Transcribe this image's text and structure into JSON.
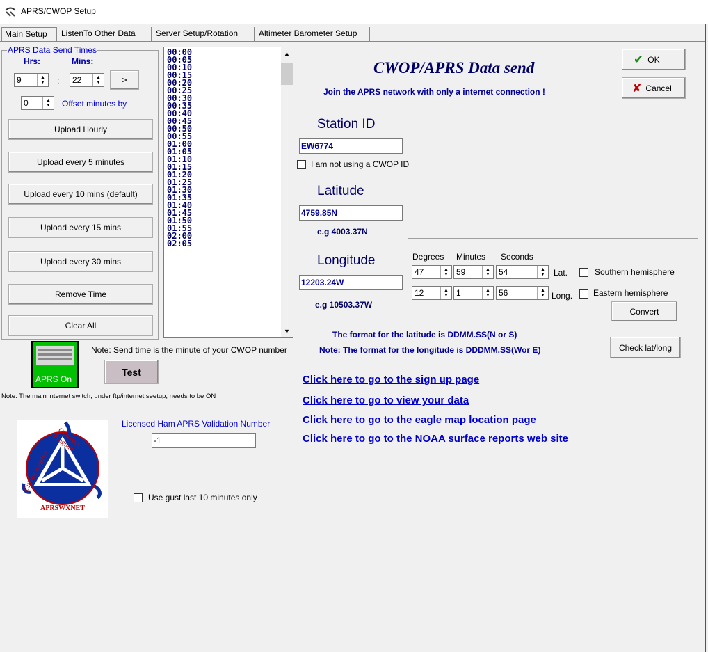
{
  "window": {
    "title": "APRS/CWOP Setup"
  },
  "tabs": [
    "Main Setup",
    "ListenTo Other Data",
    "Server Setup/Rotation",
    "Altimeter Barometer Setup"
  ],
  "send_times": {
    "group_label": "APRS Data Send Times",
    "hrs_label": "Hrs:",
    "mins_label": "Mins:",
    "hrs_value": "9",
    "mins_value": "22",
    "colon": ":",
    "arrow_button": ">",
    "offset_value": "0",
    "offset_label": "Offset minutes by"
  },
  "upload_buttons": [
    "Upload Hourly",
    "Upload every 5 minutes",
    "Upload every 10 mins (default)",
    "Upload every 15 mins",
    "Upload every 30 mins",
    "Remove Time",
    "Clear All"
  ],
  "time_list": [
    "00:00",
    "00:05",
    "00:10",
    "00:15",
    "00:20",
    "00:25",
    "00:30",
    "00:35",
    "00:40",
    "00:45",
    "00:50",
    "00:55",
    "01:00",
    "01:05",
    "01:10",
    "01:15",
    "01:20",
    "01:25",
    "01:30",
    "01:35",
    "01:40",
    "01:45",
    "01:50",
    "01:55",
    "02:00",
    "02:05"
  ],
  "toggle": {
    "label": "APRS On",
    "status_color": "#00c000"
  },
  "note_send_time": "Note: Send time is the minute of your CWOP number",
  "test_button": "Test",
  "note_internet": "Note: The main internet switch, under ftp/internet seetup, needs to be ON",
  "logo": {
    "top_text": "Observer Program",
    "left_text": "Citizen Weather",
    "bottom_text": "APRSWXNET"
  },
  "validation": {
    "label": "Licensed Ham APRS Validation Number",
    "value": "-1"
  },
  "gust_checkbox": {
    "label": "Use gust last 10 minutes only"
  },
  "header": {
    "title": "CWOP/APRS Data send",
    "subtitle": "Join the APRS network with only a internet connection !"
  },
  "ok_button": "OK",
  "cancel_button": "Cancel",
  "station": {
    "label": "Station ID",
    "value": "EW6774",
    "checkbox_label": "I am not using a CWOP ID"
  },
  "latitude": {
    "label": "Latitude",
    "value": "4759.85N",
    "example": "e.g 4003.37N"
  },
  "longitude": {
    "label": "Longitude",
    "value": "12203.24W",
    "example": "e.g 10503.37W"
  },
  "dms": {
    "degrees_label": "Degrees",
    "minutes_label": "Minutes",
    "seconds_label": "Seconds",
    "lat": {
      "deg": "47",
      "min": "59",
      "sec": "54",
      "suffix": "Lat.",
      "hemisphere_label": "Southern hemisphere"
    },
    "long": {
      "deg": "12",
      "min": "1",
      "sec": "56",
      "suffix": "Long.",
      "hemisphere_label": "Eastern hemisphere"
    },
    "convert_button": "Convert"
  },
  "format_notes": {
    "lat": "The format for the latitude is DDMM.SS(N or S)",
    "long": "Note: The format for the longitude is DDDMM.SS(Wor E)"
  },
  "check_button": "Check lat/long",
  "links": [
    "Click here to go to the sign up page",
    "Click here to go to view your data",
    "Click here to go to the eagle map location page",
    "Click here to go to the NOAA surface reports web site"
  ]
}
